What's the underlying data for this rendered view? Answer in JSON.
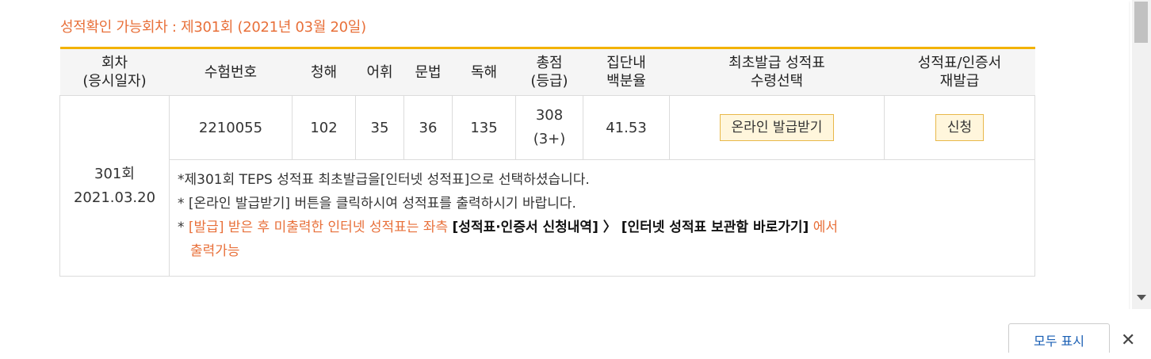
{
  "availability": "성적확인 가능회차 : 제301회 (2021년 03월 20일)",
  "table": {
    "headers": {
      "session_l1": "회차",
      "session_l2": "(응시일자)",
      "exam_no": "수험번호",
      "listening": "청해",
      "vocab": "어휘",
      "grammar": "문법",
      "reading": "독해",
      "total_l1": "총점",
      "total_l2": "(등급)",
      "percentile_l1": "집단내",
      "percentile_l2": "백분율",
      "first_issue_l1": "최초발급 성적표",
      "first_issue_l2": "수령선택",
      "reissue_l1": "성적표/인증서",
      "reissue_l2": "재발급"
    },
    "row": {
      "session": "301회",
      "date": "2021.03.20",
      "exam_no": "2210055",
      "listening": "102",
      "vocab": "35",
      "grammar": "36",
      "reading": "135",
      "total": "308",
      "grade": "(3+)",
      "percentile": "41.53",
      "online_issue_button": "온라인 발급받기",
      "apply_button": "신청"
    },
    "notes": {
      "n1": "*제301회 TEPS 성적표 최초발급을[인터넷 성적표]으로 선택하셨습니다.",
      "n2_star": "* ",
      "n2": "[온라인 발급받기] 버튼을 클릭하시여 성적표를 출력하시기 바랍니다.",
      "n3_star": "* ",
      "n3_a": "[발급] 받은 후 미출력한 인터넷 성적표는 좌측 ",
      "n3_b": "[성적표·인증서 신청내역]",
      "n3_arrow": " 〉 ",
      "n3_c": "[인터넷 성적표 보관함 바로가기]",
      "n3_d": " 에서",
      "n3_e": "출력가능"
    }
  },
  "bottom_bar": {
    "show_all": "모두 표시",
    "close": "✕"
  },
  "colors": {
    "accent_orange": "#e8703a",
    "header_border": "#f3b200",
    "button_bg": "#fff6dc",
    "link_blue": "#1a5fb4"
  }
}
